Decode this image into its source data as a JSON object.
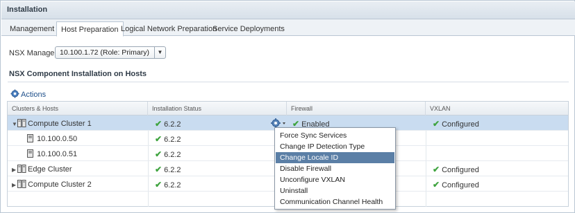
{
  "panel_title": "Installation",
  "tabs": [
    {
      "label": "Management",
      "active": false
    },
    {
      "label": "Host Preparation",
      "active": true
    },
    {
      "label": "Logical Network Preparation",
      "active": false
    },
    {
      "label": "Service Deployments",
      "active": false
    }
  ],
  "nsx_manager": {
    "label": "NSX Manager:",
    "value": "10.100.1.72 (Role: Primary)"
  },
  "section_title": "NSX Component Installation on Hosts",
  "actions_label": "Actions",
  "columns": [
    "Clusters & Hosts",
    "Installation Status",
    "Firewall",
    "VXLAN"
  ],
  "rows": [
    {
      "name": "Compute Cluster 1",
      "status": "6.2.2",
      "firewall": "Enabled",
      "vxlan": "Configured"
    },
    {
      "name": "10.100.0.50",
      "status": "6.2.2",
      "firewall": "",
      "vxlan": ""
    },
    {
      "name": "10.100.0.51",
      "status": "6.2.2",
      "firewall": "",
      "vxlan": ""
    },
    {
      "name": "Edge Cluster",
      "status": "6.2.2",
      "firewall": "",
      "vxlan": "Configured"
    },
    {
      "name": "Compute Cluster 2",
      "status": "6.2.2",
      "firewall": "",
      "vxlan": "Configured"
    }
  ],
  "context_menu": [
    "Force Sync Services",
    "Change IP Detection Type",
    "Change Locale ID",
    "Disable Firewall",
    "Unconfigure VXLAN",
    "Uninstall",
    "Communication Channel Health"
  ],
  "highlighted_menu_item": "Change Locale ID",
  "colors": {
    "accent": "#5b7fa6",
    "selected_row": "#c9dcf0",
    "check": "#3ea33e"
  }
}
